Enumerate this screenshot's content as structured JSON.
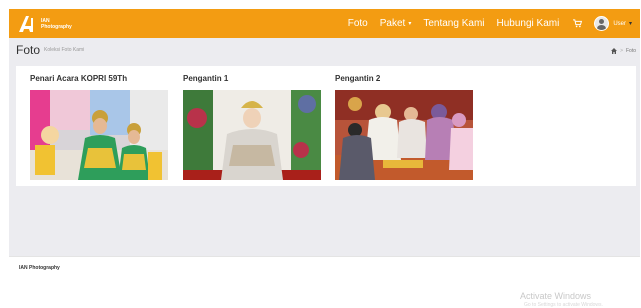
{
  "brand": {
    "line1": "IAN",
    "line2": "Photography"
  },
  "nav": {
    "foto": "Foto",
    "paket": "Paket",
    "tentang": "Tentang Kami",
    "hubungi": "Hubungi Kami",
    "user": "User",
    "caret": "▾"
  },
  "header": {
    "title": "Foto",
    "subtitle": "Koleksi Foto Kami",
    "breadcrumb_current": "Foto",
    "breadcrumb_sep": ">"
  },
  "gallery": {
    "items": [
      {
        "title": "Penari Acara KOPRI 59Th"
      },
      {
        "title": "Pengantin 1"
      },
      {
        "title": "Pengantin 2"
      }
    ]
  },
  "footer": {
    "text": "IAN Photography"
  },
  "watermark": {
    "title": "Activate Windows",
    "subtitle": "Go to Settings to activate Windows."
  },
  "colors": {
    "navbar": "#f39c12",
    "background": "#ececf0"
  },
  "icons": [
    "ian-logo-icon",
    "cart-icon",
    "avatar",
    "home-icon"
  ]
}
